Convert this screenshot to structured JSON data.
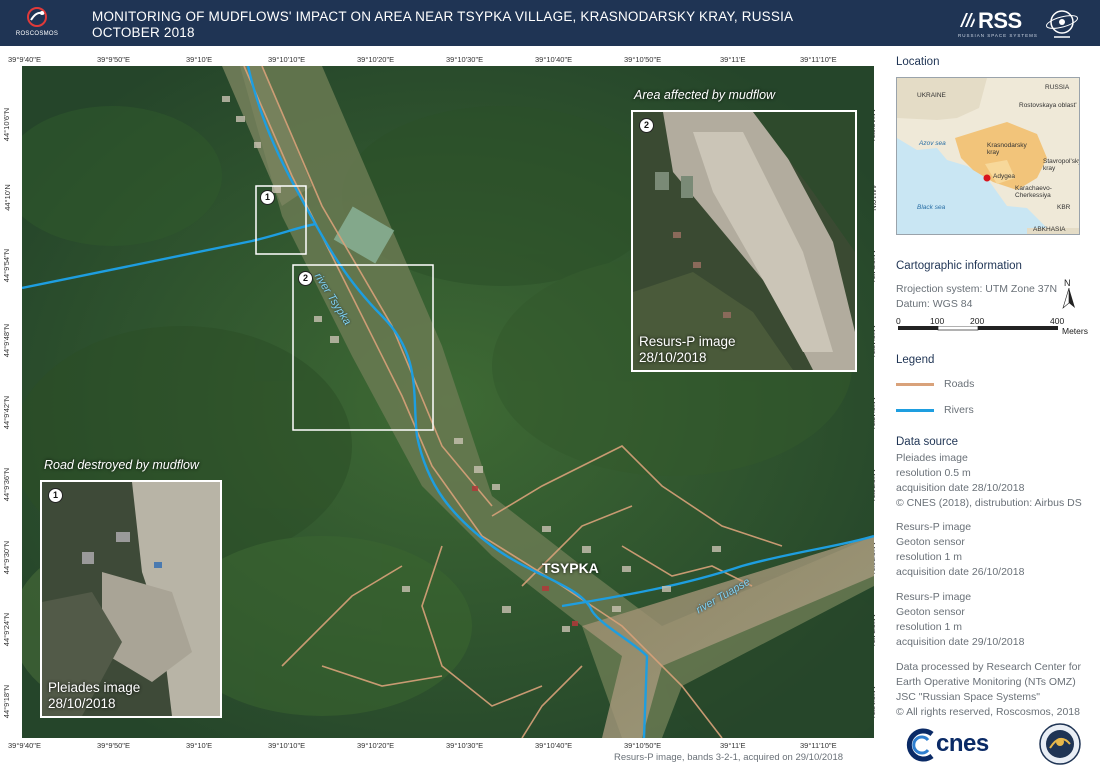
{
  "header": {
    "title_line1": "MONITORING OF MUDFLOWS' IMPACT ON AREA NEAR TSYPKA VILLAGE, KRASNODARSKY KRAY, RUSSIA",
    "title_line2": "OCTOBER 2018",
    "roscosmos_text": "ROSCOSMOS",
    "rss_text": "RSS",
    "rss_sub": "RUSSIAN   SPACE   SYSTEMS",
    "background_color": "#1f3454"
  },
  "grid": {
    "top_labels": [
      "39°9'40\"E",
      "39°9'50\"E",
      "39°10'E",
      "39°10'10\"E",
      "39°10'20\"E",
      "39°10'30\"E",
      "39°10'40\"E",
      "39°10'50\"E",
      "39°11'E",
      "39°11'10\"E"
    ],
    "bottom_labels": [
      "39°9'40\"E",
      "39°9'50\"E",
      "39°10'E",
      "39°10'10\"E",
      "39°10'20\"E",
      "39°10'30\"E",
      "39°10'40\"E",
      "39°10'50\"E",
      "39°11'E",
      "39°11'10\"E"
    ],
    "left_labels": [
      "44°10'6\"N",
      "44°10'N",
      "44°9'54\"N",
      "44°9'48\"N",
      "44°9'42\"N",
      "44°9'36\"N",
      "44°9'30\"N",
      "44°9'24\"N",
      "44°9'18\"N"
    ],
    "right_labels": [
      "44°10'6\"N",
      "44°10'N",
      "44°9'54\"N",
      "44°9'48\"N",
      "44°9'42\"N",
      "44°9'36\"N",
      "44°9'30\"N",
      "44°9'24\"N",
      "44°9'18\"N"
    ]
  },
  "map": {
    "village_label": "TSYPKA",
    "river_tsypka_label": "river Tsypka",
    "river_tuapse_label": "river Tuapse",
    "box1_number": "1",
    "box2_number": "2",
    "road_color": "#d9a27a",
    "river_color": "#1e9ee0"
  },
  "inset_right": {
    "title": "Area affected by mudflow",
    "number": "2",
    "caption_line1": "Resurs-P image",
    "caption_line2": "28/10/2018"
  },
  "inset_left": {
    "title": "Road destroyed by mudflow",
    "number": "1",
    "caption_line1": "Pleiades image",
    "caption_line2": "28/10/2018"
  },
  "panel": {
    "location_heading": "Location",
    "location_labels": {
      "ukraine": "UKRAINE",
      "russia": "RUSSIA",
      "rostov": "Rostovskaya oblast'",
      "azov": "Azov sea",
      "krasnodar": "Krasnodarsky kray",
      "stavropol": "Stavropol'sky kray",
      "adygea": "Adygea",
      "kchr": "Karachaevo-Cherkessiya",
      "kbr": "KBR",
      "black_sea": "Black sea",
      "abkhasia": "ABKHASIA"
    },
    "carto_heading": "Cartographic information",
    "projection": "Rrojection system: UTM Zone 37N",
    "datum": "Datum: WGS 84",
    "north_label": "N",
    "scale_ticks": [
      "0",
      "100",
      "200",
      "400"
    ],
    "scale_unit": "Meters",
    "legend_heading": "Legend",
    "legend_roads": "Roads",
    "legend_rivers": "Rivers",
    "data_source_heading": "Data source",
    "source1": [
      "Pleiades image",
      "resolution 0.5 m",
      "acquisition date 28/10/2018",
      "© CNES (2018), distrubution: Airbus DS"
    ],
    "source2": [
      "Resurs-P image",
      "Geoton sensor",
      "resolution 1 m",
      "acquisition date 26/10/2018"
    ],
    "source3": [
      "Resurs-P image",
      "Geoton sensor",
      "resolution 1 m",
      "acquisition date 29/10/2018"
    ],
    "processed": [
      "Data processed by Research Center for",
      "Earth Operative Monitoring (NTs OMZ)",
      "JSC \"Russian Space Systems\"",
      "© All rights reserved, Roscosmos, 2018"
    ]
  },
  "footer": {
    "caption": "Resurs-P image, bands 3-2-1, acquired on 29/10/2018",
    "cnes_text": "cnes"
  }
}
